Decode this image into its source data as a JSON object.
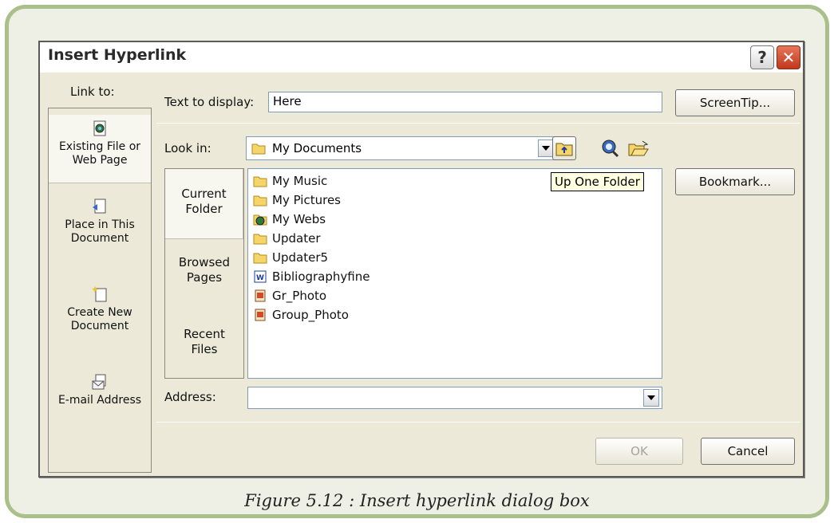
{
  "dialog": {
    "title": "Insert Hyperlink",
    "help_label": "?",
    "close_label": "✕"
  },
  "link_to": {
    "label": "Link to:",
    "items": [
      {
        "line1": "Existing File or",
        "line2": "Web Page",
        "icon": "web-file-icon"
      },
      {
        "line1": "Place in This",
        "line2": "Document",
        "icon": "document-place-icon"
      },
      {
        "line1": "Create New",
        "line2": "Document",
        "icon": "new-document-icon"
      },
      {
        "line1": "E-mail Address",
        "line2": "",
        "icon": "email-icon"
      }
    ]
  },
  "text_to_display": {
    "label": "Text to display:",
    "value": "Here"
  },
  "screentip_button": "ScreenTip...",
  "look_in": {
    "label": "Look in:",
    "value": "My Documents",
    "tools": [
      "up-one-folder-icon",
      "search-web-icon",
      "browse-file-icon"
    ]
  },
  "tooltip": "Up One Folder",
  "look_tabs": [
    {
      "line1": "Current",
      "line2": "Folder"
    },
    {
      "line1": "Browsed",
      "line2": "Pages"
    },
    {
      "line1": "Recent",
      "line2": "Files"
    }
  ],
  "files": [
    {
      "name": "My Music",
      "icon": "folder-icon"
    },
    {
      "name": "My Pictures",
      "icon": "folder-icon"
    },
    {
      "name": "My Webs",
      "icon": "webs-folder-icon"
    },
    {
      "name": "Updater",
      "icon": "folder-icon"
    },
    {
      "name": "Updater5",
      "icon": "folder-icon"
    },
    {
      "name": "Bibliographyfine",
      "icon": "word-doc-icon"
    },
    {
      "name": "Gr_Photo",
      "icon": "image-file-icon"
    },
    {
      "name": "Group_Photo",
      "icon": "image-file-icon"
    }
  ],
  "bookmark_button": "Bookmark...",
  "address": {
    "label": "Address:",
    "value": ""
  },
  "ok_button": "OK",
  "cancel_button": "Cancel",
  "caption": "Figure 5.12 : Insert hyperlink dialog box",
  "colors": {
    "frame_border": "#a9c08a",
    "dialog_bg": "#ece9d8",
    "close_red": "#c1381c",
    "tooltip_bg": "#ffffe1"
  }
}
